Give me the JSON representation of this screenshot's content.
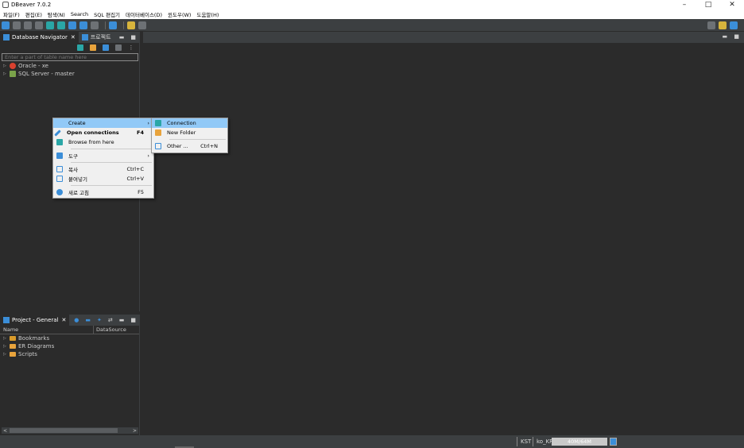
{
  "window": {
    "title": "DBeaver 7.0.2",
    "controls": [
      "–",
      "□",
      "✕"
    ]
  },
  "menubar": {
    "items": [
      "파일(F)",
      "편집(E)",
      "탐색(N)",
      "Search",
      "SQL 편집기",
      "데이터베이스(D)",
      "윈도우(W)",
      "도움말(H)"
    ]
  },
  "navigator": {
    "tabs": [
      {
        "label": "Database Navigator"
      },
      {
        "label": "프로젝트"
      }
    ],
    "filter_placeholder": "Enter a part of table name here",
    "connections": [
      {
        "label": "Oracle - xe",
        "icon": "oracle-icon"
      },
      {
        "label": "SQL Server - master",
        "icon": "sqlserver-icon"
      }
    ]
  },
  "context_menu": {
    "items": [
      {
        "label": "Create",
        "shortcut": "",
        "icon": "",
        "submenu": true
      },
      {
        "label": "Open connections",
        "shortcut": "F4",
        "icon": "connect-icon"
      },
      {
        "label": "Browse from here",
        "shortcut": "",
        "icon": "browse-icon"
      },
      {
        "label": "도구",
        "shortcut": "",
        "icon": "tools-icon",
        "submenu": true
      },
      {
        "label": "복사",
        "shortcut": "Ctrl+C",
        "icon": "copy-icon"
      },
      {
        "label": "붙여넣기",
        "shortcut": "Ctrl+V",
        "icon": "paste-icon"
      },
      {
        "label": "새로 고침",
        "shortcut": "F5",
        "icon": "refresh-icon"
      }
    ]
  },
  "submenu": {
    "items": [
      {
        "label": "Connection",
        "shortcut": "",
        "icon": "new-connection-icon"
      },
      {
        "label": "New Folder",
        "shortcut": "",
        "icon": "folder-icon"
      },
      {
        "label": "Other ...",
        "shortcut": "Ctrl+N",
        "icon": "other-icon"
      }
    ]
  },
  "project": {
    "tab_label": "Project - General",
    "columns": [
      "Name",
      "DataSource"
    ],
    "items": [
      "Bookmarks",
      "ER Diagrams",
      "Scripts"
    ]
  },
  "statusbar": {
    "timezone": "KST",
    "locale": "ko_KR",
    "memory": "40M/64M"
  },
  "colors": {
    "accent": "#3b8ed8",
    "highlight": "#91c9f7",
    "background": "#2b2b2b",
    "panel": "#3c3f41"
  }
}
